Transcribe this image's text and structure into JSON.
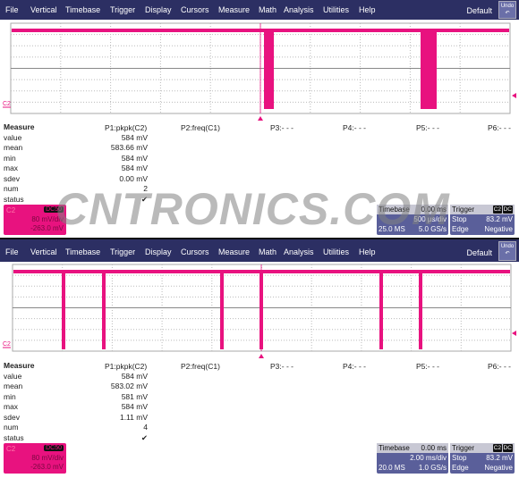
{
  "menu": [
    "File",
    "Vertical",
    "Timebase",
    "Trigger",
    "Display",
    "Cursors",
    "Measure",
    "Math",
    "Analysis",
    "Utilities",
    "Help"
  ],
  "default_label": "Default",
  "undo_label": "Undo",
  "trace_color": "#e8127f",
  "channel_label": "C2",
  "watermark": "CNTRONICS.COM",
  "panels": [
    {
      "measure": {
        "title": "Measure",
        "rows": [
          "value",
          "mean",
          "min",
          "max",
          "sdev",
          "num",
          "status"
        ],
        "params": [
          "P1:pkpk(C2)",
          "P2:freq(C1)",
          "P3:- - -",
          "P4:- - -",
          "P5:- - -",
          "P6:- - -"
        ],
        "p1_values": [
          "584 mV",
          "583.66 mV",
          "584 mV",
          "584 mV",
          "0.00 mV",
          "2",
          "✔"
        ]
      },
      "channel": {
        "name": "C2",
        "coupling": "DC50",
        "scale": "80 mV/div",
        "offset": "-263.0 mV"
      },
      "timebase": {
        "label": "Timebase",
        "delay": "0.00 ms",
        "scale": "500 µs/div",
        "samples": "25.0 MS",
        "rate": "5.0 GS/s"
      },
      "trigger": {
        "label": "Trigger",
        "source": "C2",
        "coupling": "DC",
        "mode": "Stop",
        "level": "83.2 mV",
        "type": "Edge",
        "slope": "Negative"
      }
    },
    {
      "measure": {
        "title": "Measure",
        "rows": [
          "value",
          "mean",
          "min",
          "max",
          "sdev",
          "num",
          "status"
        ],
        "params": [
          "P1:pkpk(C2)",
          "P2:freq(C1)",
          "P3:- - -",
          "P4:- - -",
          "P5:- - -",
          "P6:- - -"
        ],
        "p1_values": [
          "584 mV",
          "583.02 mV",
          "581 mV",
          "584 mV",
          "1.11 mV",
          "4",
          "✔"
        ]
      },
      "channel": {
        "name": "C2",
        "coupling": "DC50",
        "scale": "80 mV/div",
        "offset": "-263.0 mV"
      },
      "timebase": {
        "label": "Timebase",
        "delay": "0.00 ms",
        "scale": "2.00 ms/div",
        "samples": "20.0 MS",
        "rate": "1.0 GS/s"
      },
      "trigger": {
        "label": "Trigger",
        "source": "C2",
        "coupling": "DC",
        "mode": "Stop",
        "level": "83.2 mV",
        "type": "Edge",
        "slope": "Negative"
      }
    }
  ]
}
